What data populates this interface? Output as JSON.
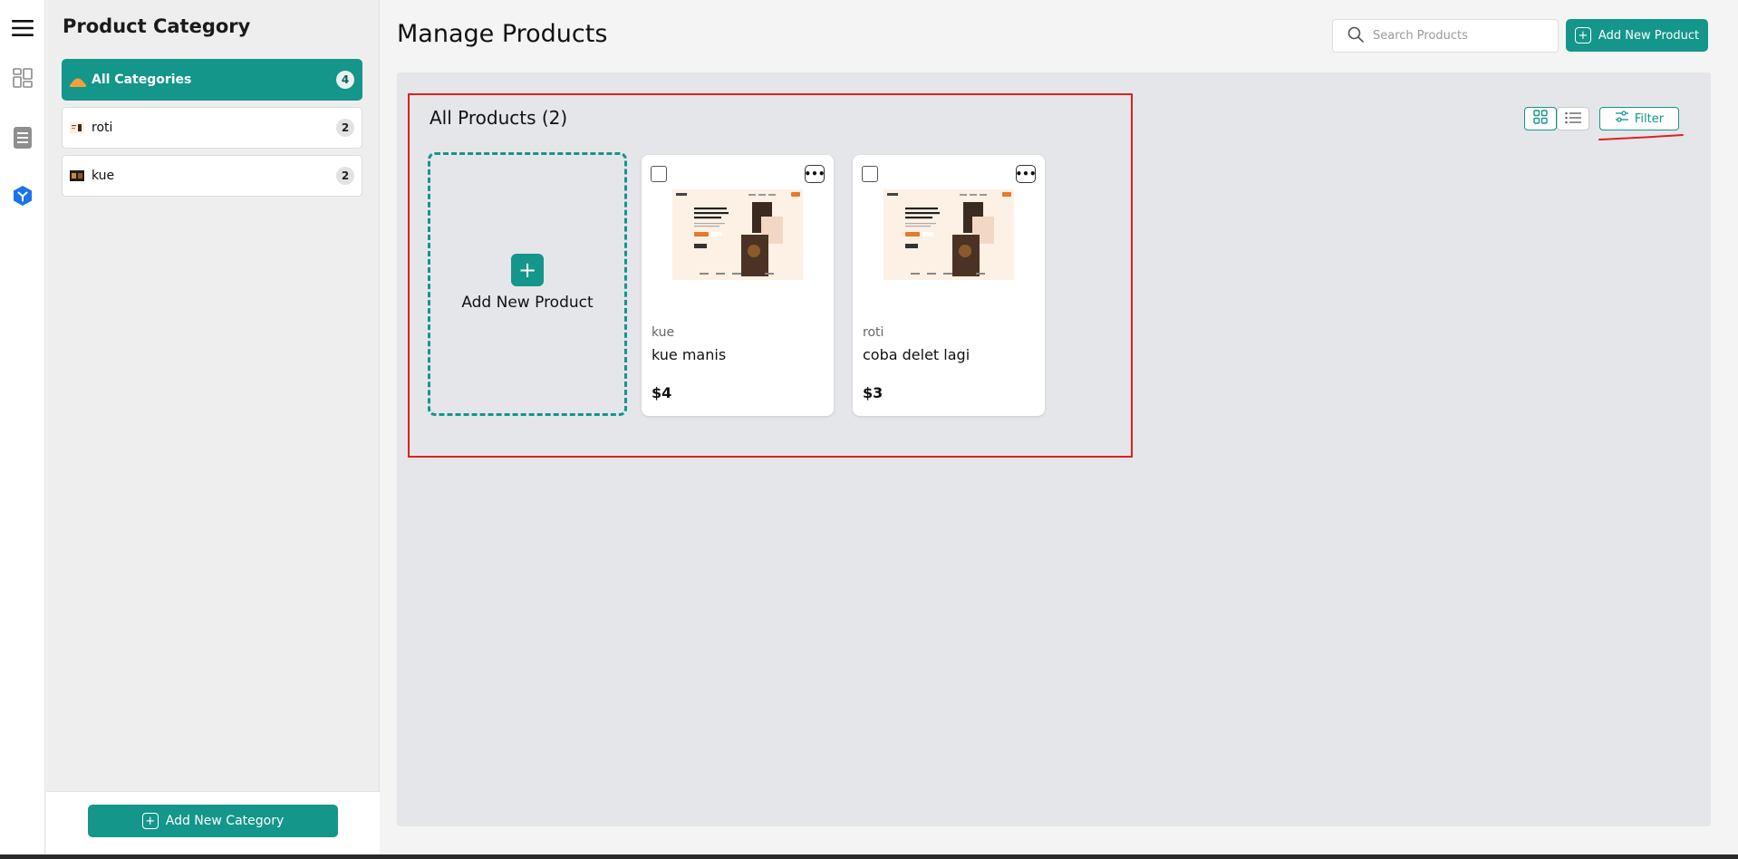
{
  "rail": {
    "icons": [
      "menu-icon",
      "dashboard-icon",
      "document-icon",
      "product-icon"
    ],
    "accent": "#1a73e8"
  },
  "sidebar": {
    "title": "Product Category",
    "categories": [
      {
        "label": "All Categories",
        "count": "4",
        "active": true
      },
      {
        "label": "roti",
        "count": "2",
        "active": false
      },
      {
        "label": "kue",
        "count": "2",
        "active": false
      }
    ],
    "add_category_label": "Add New Category"
  },
  "header": {
    "title": "Manage Products",
    "search_placeholder": "Search Products",
    "add_product_label": "Add New Product"
  },
  "main": {
    "products_title": "All Products (2)",
    "add_card_label": "Add New Product",
    "filter_label": "Filter",
    "view_modes": [
      "grid-view-icon",
      "list-view-icon"
    ],
    "products": [
      {
        "category": "kue",
        "name": "kue manis",
        "price": "$4",
        "thumb_headline": "A healthy meal delivered to your door, every single day"
      },
      {
        "category": "roti",
        "name": "coba delet lagi",
        "price": "$3",
        "thumb_headline": "A healthy meal delivered to your door, every single day"
      }
    ]
  },
  "colors": {
    "brand": "#14968a",
    "annotation": "#e02020",
    "panel": "#e5e6ea"
  }
}
